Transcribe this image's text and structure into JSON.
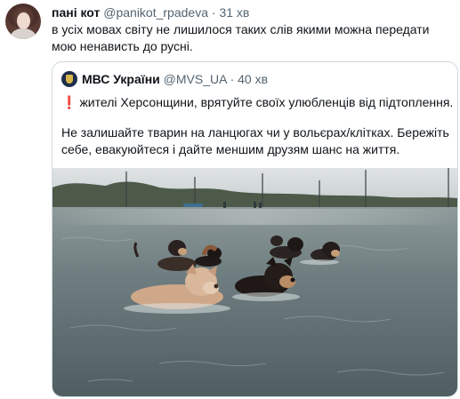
{
  "tweet": {
    "author_name": "пані кот",
    "author_handle": "@panikot_rpadeva",
    "separator": "·",
    "time": "31 хв",
    "text": "в усіх мовах світу не лишилося таких слів якими можна передати мою ненависть до русні."
  },
  "quoted_tweet": {
    "author_name": "МВС України",
    "author_handle": "@MVS_UA",
    "separator": "·",
    "time": "40 хв",
    "exclamation_icon": "❗",
    "line1": "жителі Херсонщини, врятуйте своїх улюбленців від підтоплення.",
    "line2": "Не залишайте тварин на ланцюгах чи у вольєрах/клітках. Бережіть себе, евакуюйтеся і дайте меншим друзям шанс на життя."
  },
  "colors": {
    "text_primary": "#0f1419",
    "text_secondary": "#536471",
    "border": "#cfd9de",
    "exclamation": "#d4202c"
  },
  "icons": {
    "avatar": "user-avatar",
    "quote_avatar": "police-emblem-icon",
    "exclamation": "exclamation-icon"
  }
}
